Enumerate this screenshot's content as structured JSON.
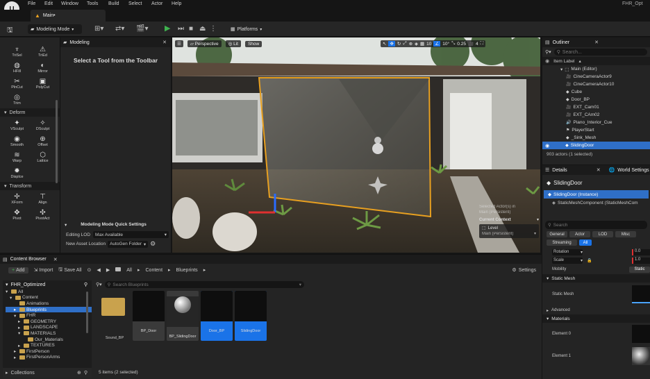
{
  "menubar": {
    "logo": "U",
    "items": [
      "File",
      "Edit",
      "Window",
      "Tools",
      "Build",
      "Select",
      "Actor",
      "Help"
    ],
    "project_name": "FHR_Opt"
  },
  "tabs": {
    "main": "Main•"
  },
  "toolbar": {
    "mode": "Modeling Mode",
    "platforms": "Platforms"
  },
  "palette": {
    "top_tools": [
      {
        "icon": "♆",
        "label": "TriSel"
      },
      {
        "icon": "⚠",
        "label": "TriEd"
      },
      {
        "icon": "◍",
        "label": "HFill"
      },
      {
        "icon": "◐",
        "label": "Mirror"
      },
      {
        "icon": "✂",
        "label": "PlnCut"
      },
      {
        "icon": "▣",
        "label": "PolyCut"
      },
      {
        "icon": "◎",
        "label": "Trim"
      }
    ],
    "deform_label": "Deform",
    "deform_tools": [
      {
        "icon": "✦",
        "label": "VSculpt"
      },
      {
        "icon": "✧",
        "label": "DSculpt"
      },
      {
        "icon": "◉",
        "label": "Smooth"
      },
      {
        "icon": "⊕",
        "label": "Offset"
      },
      {
        "icon": "≋",
        "label": "Warp"
      },
      {
        "icon": "⬡",
        "label": "Lattice"
      },
      {
        "icon": "✹",
        "label": "Displce"
      }
    ],
    "transform_label": "Transform",
    "transform_tools": [
      {
        "icon": "✢",
        "label": "XForm"
      },
      {
        "icon": "⊤",
        "label": "Align"
      },
      {
        "icon": "✥",
        "label": "Pivot"
      },
      {
        "icon": "✣",
        "label": "PivotAct"
      }
    ]
  },
  "modeling": {
    "tab_title": "Modeling",
    "select_prompt": "Select a Tool from the Toolbar",
    "quick_settings": "Modeling Mode Quick Settings",
    "editing_lod_label": "Editing LOD",
    "editing_lod_value": "Max Available",
    "new_asset_label": "New Asset Location",
    "new_asset_value": "AutoGen Folder"
  },
  "viewport": {
    "perspective": "Perspective",
    "lit": "Lit",
    "show": "Show",
    "snap_value": "10",
    "angle_value": "10°",
    "scale_value": "0.25",
    "camera_speed": "4",
    "overlay_selected": "Selected Actor(s) in",
    "overlay_main": "Main (Persistent)",
    "overlay_context_label": "Current Context",
    "overlay_level_label": "Level",
    "overlay_level_value": "Main (Persistent)"
  },
  "outliner": {
    "title": "Outliner",
    "search_placeholder": "Search...",
    "column": "Item Label",
    "root": "Main (Editor)",
    "items": [
      {
        "icon": "🎥",
        "label": "CineCameraActor9"
      },
      {
        "icon": "🎥",
        "label": "CineCameraActor10"
      },
      {
        "icon": "◆",
        "label": "Cube"
      },
      {
        "icon": "◆",
        "label": "Door_BP"
      },
      {
        "icon": "🎥",
        "label": "EXT_Cam01"
      },
      {
        "icon": "🎥",
        "label": "EXT_CAm02"
      },
      {
        "icon": "🔊",
        "label": "Piano_Interior_Cue"
      },
      {
        "icon": "⚑",
        "label": "PlayerStart"
      },
      {
        "icon": "◆",
        "label": "_Sink_Mesh"
      },
      {
        "icon": "◆",
        "label": "SlidingDoor"
      }
    ],
    "count": "903 actors (1 selected)"
  },
  "details": {
    "tab_details": "Details",
    "tab_world": "World Settings",
    "object_name": "SlidingDoor",
    "instance_label": "SlidingDoor (Instance)",
    "component_label": "StaticMeshComponent (StaticMeshCom",
    "search_placeholder": "Search",
    "filters_row1": [
      "General",
      "Actor",
      "LOD",
      "Misc"
    ],
    "filters_row2": [
      "Streaming",
      "All"
    ],
    "rotation_label": "Rotation",
    "rotation_value": "0.0",
    "scale_label": "Scale",
    "scale_value": "1.0",
    "mobility_label": "Mobility",
    "mobility_value": "Static",
    "static_mesh_section": "Static Mesh",
    "static_mesh_label": "Static Mesh",
    "advanced_label": "Advanced",
    "materials_section": "Materials",
    "element0": "Element 0",
    "element1": "Element 1"
  },
  "content_browser": {
    "tab_title": "Content Browser",
    "add_label": "Add",
    "import_label": "Import",
    "save_all_label": "Save All",
    "path": [
      "All",
      "Content",
      "Blueprints"
    ],
    "settings_label": "Settings",
    "project_root": "FHR_Optimized",
    "search_placeholder": "Search Blueprints",
    "tree": [
      {
        "label": "All",
        "depth": 0,
        "arrow": "▾"
      },
      {
        "label": "Content",
        "depth": 1,
        "arrow": "▾"
      },
      {
        "label": "Animations",
        "depth": 2,
        "arrow": ""
      },
      {
        "label": "Blueprints",
        "depth": 2,
        "arrow": "▸"
      },
      {
        "label": "FHR",
        "depth": 2,
        "arrow": "▾"
      },
      {
        "label": "GEOMETRY",
        "depth": 3,
        "arrow": "▸"
      },
      {
        "label": "LANDSCAPE",
        "depth": 3,
        "arrow": "▸"
      },
      {
        "label": "MATERIALS",
        "depth": 3,
        "arrow": "▾"
      },
      {
        "label": "Our_Materials",
        "depth": 4,
        "arrow": ""
      },
      {
        "label": "TEXTURES",
        "depth": 3,
        "arrow": "▸"
      },
      {
        "label": "FirstPerson",
        "depth": 2,
        "arrow": "▸"
      },
      {
        "label": "FirstPersonArms",
        "depth": 2,
        "arrow": "▸"
      }
    ],
    "collections_label": "Collections",
    "assets": [
      {
        "label": "Sound_BP",
        "type": "folder",
        "selected": false
      },
      {
        "label": "BP_Door",
        "type": "blueprint",
        "selected": false
      },
      {
        "label": "BP_SlidingDoor",
        "type": "sphere",
        "selected": false
      },
      {
        "label": "Door_BP",
        "type": "blueprint",
        "selected": true
      },
      {
        "label": "SlidingDoor",
        "type": "blueprint",
        "selected": true
      }
    ],
    "status": "5 items (2 selected)"
  },
  "colors": {
    "accent_blue": "#1a73e8",
    "selection_blue": "#2f6fc7",
    "gizmo_orange": "#e8a020",
    "play_green": "#3fb34f",
    "folder": "#c9a24d"
  }
}
